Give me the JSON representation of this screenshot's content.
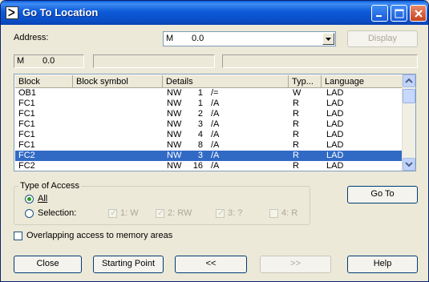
{
  "window": {
    "title": "Go To Location"
  },
  "address": {
    "label": "Address:",
    "value_area": "M",
    "value_addr": "0.0",
    "display_button": "Display"
  },
  "status": {
    "area": "M",
    "addr": "0.0"
  },
  "table": {
    "columns": [
      "Block",
      "Block symbol",
      "Details",
      "Typ...",
      "Language"
    ],
    "rows": [
      {
        "block": "OB1",
        "symbol": "",
        "nw": "NW",
        "num": "1",
        "op": "/=",
        "type": "W",
        "lang": "LAD"
      },
      {
        "block": "FC1",
        "symbol": "",
        "nw": "NW",
        "num": "1",
        "op": "/A",
        "type": "R",
        "lang": "LAD"
      },
      {
        "block": "FC1",
        "symbol": "",
        "nw": "NW",
        "num": "2",
        "op": "/A",
        "type": "R",
        "lang": "LAD"
      },
      {
        "block": "FC1",
        "symbol": "",
        "nw": "NW",
        "num": "3",
        "op": "/A",
        "type": "R",
        "lang": "LAD"
      },
      {
        "block": "FC1",
        "symbol": "",
        "nw": "NW",
        "num": "4",
        "op": "/A",
        "type": "R",
        "lang": "LAD"
      },
      {
        "block": "FC1",
        "symbol": "",
        "nw": "NW",
        "num": "8",
        "op": "/A",
        "type": "R",
        "lang": "LAD"
      },
      {
        "block": "FC2",
        "symbol": "",
        "nw": "NW",
        "num": "3",
        "op": "/A",
        "type": "R",
        "lang": "LAD",
        "selected": true
      },
      {
        "block": "FC2",
        "symbol": "",
        "nw": "NW",
        "num": "16",
        "op": "/A",
        "type": "R",
        "lang": "LAD"
      }
    ]
  },
  "access": {
    "group_title": "Type of Access",
    "all_label": "All",
    "selection_label": "Selection:",
    "options": [
      "1: W",
      "2: RW",
      "3: ?",
      "4: R"
    ]
  },
  "goto_button": "Go To",
  "overlap_label": "Overlapping access to memory areas",
  "buttons": {
    "close": "Close",
    "starting_point": "Starting Point",
    "prev": "<<",
    "next": ">>",
    "help": "Help"
  }
}
